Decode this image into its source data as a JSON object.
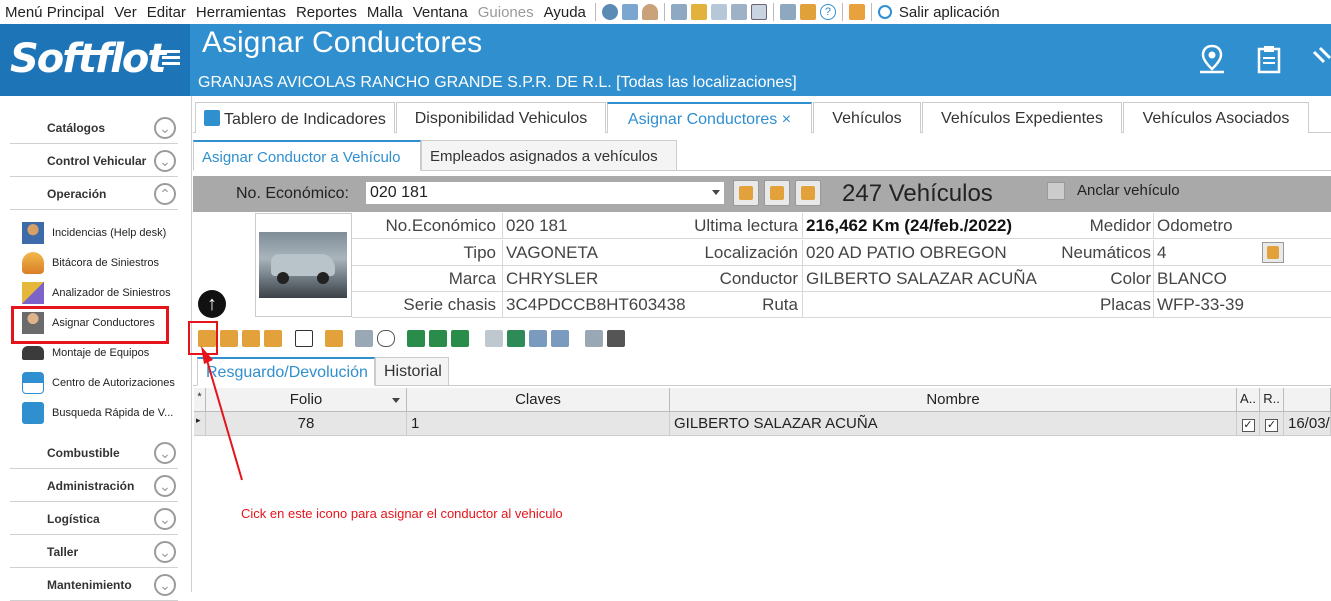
{
  "menubar": {
    "items": [
      "Menú Principal",
      "Ver",
      "Editar",
      "Herramientas",
      "Reportes",
      "Malla",
      "Ventana",
      "Guiones",
      "Ayuda"
    ],
    "disabled_item": "Guiones",
    "exit_label": "Salir aplicación"
  },
  "header": {
    "logo": "Softflot",
    "title": "Asignar Conductores",
    "company": "GRANJAS AVICOLAS RANCHO GRANDE S.P.R. DE R.L. [Todas las localizaciones]"
  },
  "sidebar": {
    "categories": {
      "catalogos": "Catálogos",
      "control": "Control Vehicular",
      "operacion": "Operación",
      "combustible": "Combustible",
      "administracion": "Administración",
      "logistica": "Logística",
      "taller": "Taller",
      "mantenimiento": "Mantenimiento"
    },
    "items": {
      "incidencias": "Incidencias (Help desk)",
      "bitacora": "Bitácora de Siniestros",
      "analizador": "Analizador de Siniestros",
      "asignar": "Asignar Conductores",
      "montaje": "Montaje de Equipos",
      "centro": "Centro de Autorizaciones",
      "busqueda": "Busqueda Rápida de V..."
    }
  },
  "tabs": {
    "t1": "Tablero de Indicadores",
    "t2": "Disponibilidad Vehiculos",
    "t3": "Asignar Conductores",
    "t4": "Vehículos",
    "t5": "Vehículos Expedientes",
    "t6": "Vehículos Asociados"
  },
  "subtabs": {
    "s1": "Asignar Conductor a Vehículo",
    "s2": "Empleados asignados a vehículos"
  },
  "search": {
    "label": "No. Económico:",
    "value": "020 181",
    "count": "247 Vehículos",
    "anchor_label": "Anclar vehículo"
  },
  "vehicle": {
    "no_eco_label": "No.Económico",
    "no_eco": "020 181",
    "lectura_label": "Ultima lectura",
    "lectura": "216,462 Km  (24/feb./2022)",
    "medidor_label": "Medidor",
    "medidor": "Odometro",
    "tipo_label": "Tipo",
    "tipo": "VAGONETA",
    "local_label": "Localización",
    "local": "020 AD PATIO OBREGON",
    "neum_label": "Neumáticos",
    "neum": "4",
    "marca_label": "Marca",
    "marca": "CHRYSLER",
    "cond_label": "Conductor",
    "cond": "GILBERTO SALAZAR ACUÑA",
    "color_label": "Color",
    "color": "BLANCO",
    "serie_label": "Serie chasis",
    "serie": "3C4PDCCB8HT603438",
    "ruta_label": "Ruta",
    "ruta": "",
    "placas_label": "Placas",
    "placas": "WFP-33-39"
  },
  "bottom_tabs": {
    "b1": "Resguardo/Devolución",
    "b2": "Historial"
  },
  "grid": {
    "headers": {
      "folio": "Folio",
      "claves": "Claves",
      "nombre": "Nombre",
      "a": "A..",
      "r": "R..",
      "star": "*"
    },
    "row": {
      "folio": "78",
      "claves": "1",
      "nombre": "GILBERTO SALAZAR ACUÑA",
      "a": "✓",
      "r": "✓",
      "date": "16/03/"
    }
  },
  "annotation": {
    "note": "Cick en este icono para asignar el conductor al vehiculo",
    "arrow_glyph": "↑"
  },
  "colors": {
    "accent": "#2f8fcf",
    "highlight": "#e5141b"
  }
}
